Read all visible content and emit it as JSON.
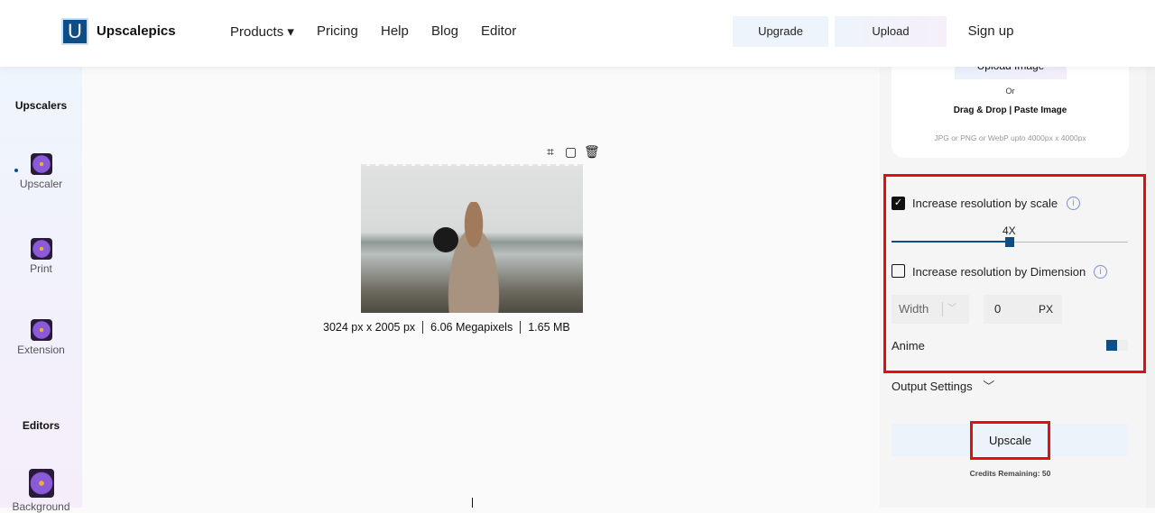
{
  "header": {
    "logo_letter": "U",
    "brand": "Upscalepics",
    "nav": [
      {
        "label": "Products ▾"
      },
      {
        "label": "Pricing"
      },
      {
        "label": "Help"
      },
      {
        "label": "Blog"
      },
      {
        "label": "Editor"
      }
    ],
    "upgrade": "Upgrade",
    "upload": "Upload",
    "signup": "Sign up"
  },
  "sidebar": {
    "upscalers_heading": "Upscalers",
    "items": [
      {
        "label": "Upscaler"
      },
      {
        "label": "Print"
      },
      {
        "label": "Extension"
      }
    ],
    "editors_heading": "Editors",
    "editor_items": [
      {
        "label": "Background"
      }
    ]
  },
  "image": {
    "dimensions": "3024 px x 2005 px",
    "megapixels": "6.06 Megapixels",
    "size": "1.65 MB"
  },
  "upload_card": {
    "button": "Upload Image",
    "or": "Or",
    "drag": "Drag & Drop | Paste Image",
    "formats": "JPG or PNG or WebP upto 4000px x 4000px"
  },
  "settings": {
    "scale_label": "Increase resolution by scale",
    "scale_checked": true,
    "scale_value": "4X",
    "scale_fraction": 0.5,
    "dimension_label": "Increase resolution by Dimension",
    "dimension_checked": false,
    "dimension_select": "Width",
    "dimension_value": "0",
    "unit": "PX",
    "anime_label": "Anime",
    "anime_on": true,
    "output_settings": "Output Settings"
  },
  "upscale": {
    "label": "Upscale",
    "credits": "Credits Remaining: 50"
  },
  "colors": {
    "accent": "#0e4d86",
    "highlight": "#e01010"
  }
}
